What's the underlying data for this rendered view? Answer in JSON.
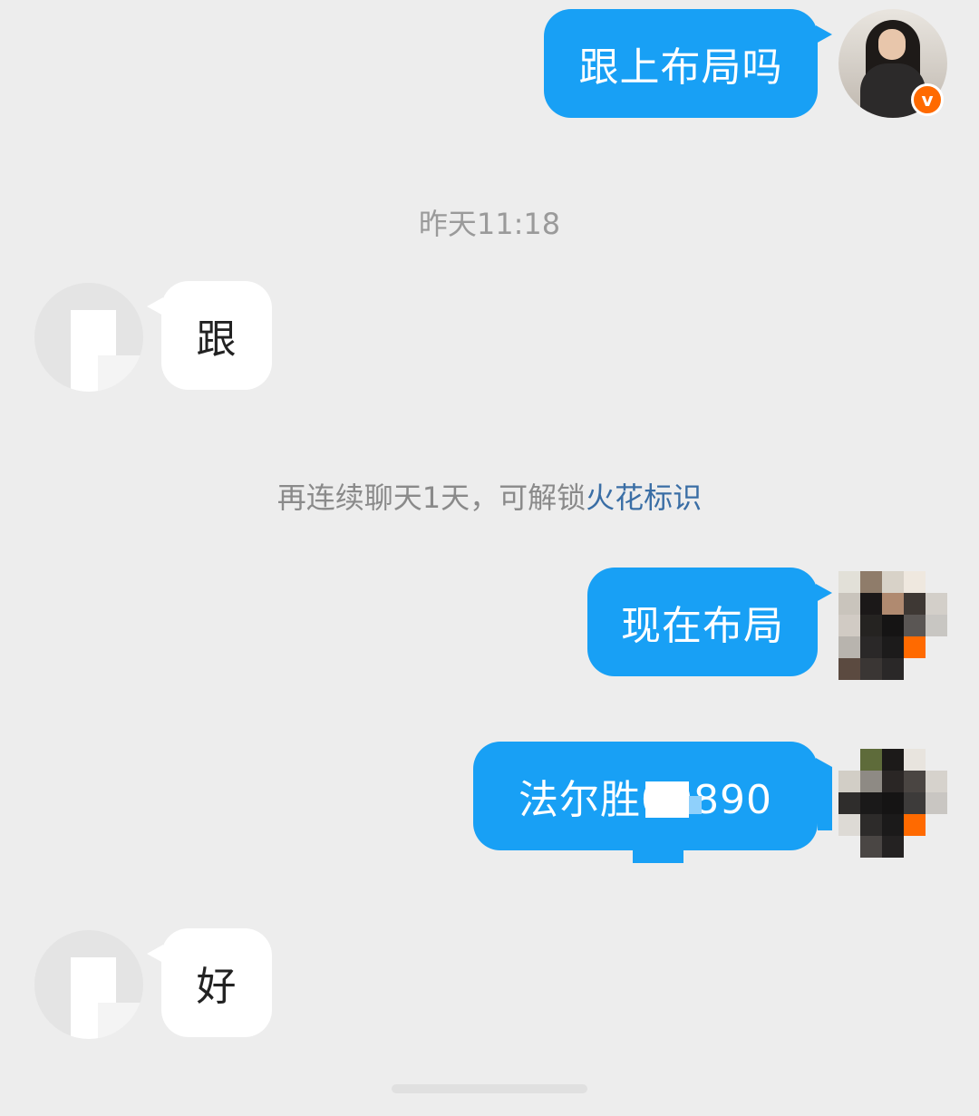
{
  "messages": {
    "m1": {
      "text": "跟上布局吗"
    },
    "m2": {
      "text": "跟"
    },
    "m3": {
      "text": "现在布局"
    },
    "m4": {
      "text": "法尔胜00890"
    },
    "m5": {
      "text": "好"
    }
  },
  "timestamp": "昨天11:18",
  "system_notice": {
    "prefix": "再连续聊天1天，可解锁",
    "link": "火花标识"
  },
  "badge": {
    "label": "v"
  },
  "colors": {
    "background": "#ededed",
    "outgoing_bubble": "#18a0f5",
    "incoming_bubble": "#ffffff",
    "link": "#3a6ea5",
    "badge": "#ff6a00"
  }
}
